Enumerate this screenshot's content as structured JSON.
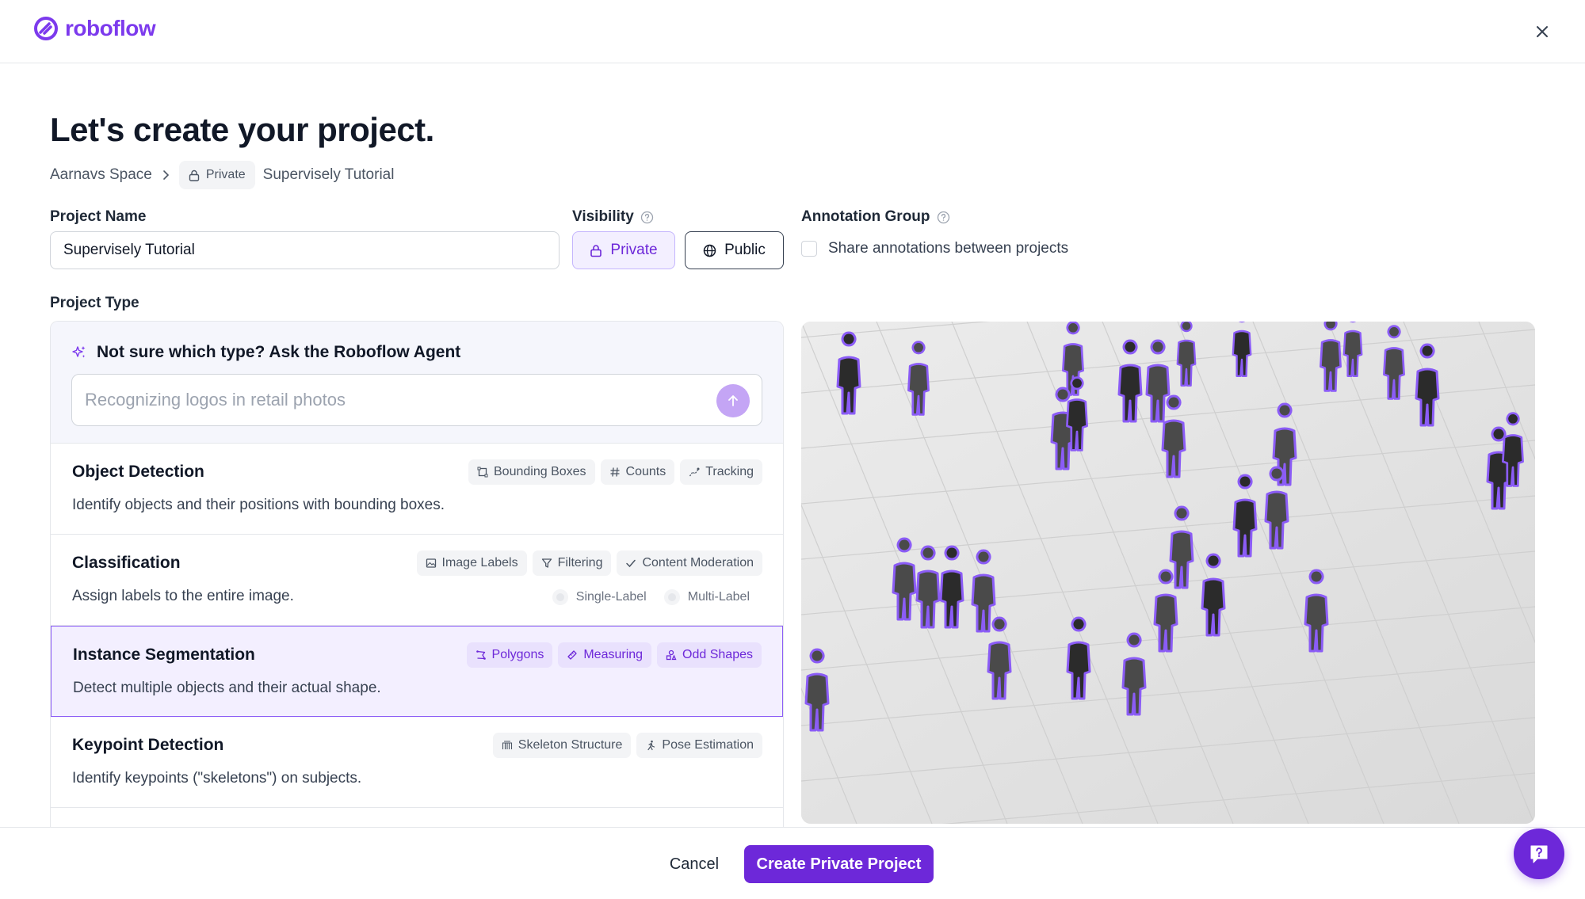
{
  "app": {
    "logo_text": "roboflow",
    "brand_color": "#6d28d9"
  },
  "page": {
    "title": "Let's create your project."
  },
  "breadcrumb": {
    "workspace": "Aarnavs Space",
    "visibility_badge": "Private",
    "project": "Supervisely Tutorial"
  },
  "form": {
    "project_name_label": "Project Name",
    "project_name_value": "Supervisely Tutorial",
    "visibility_label": "Visibility",
    "visibility_options": {
      "private": "Private",
      "public": "Public"
    },
    "visibility_selected": "Private",
    "annotation_group_label": "Annotation Group",
    "share_annotations_label": "Share annotations between projects",
    "share_annotations_checked": false,
    "project_type_label": "Project Type"
  },
  "agent": {
    "title": "Not sure which type? Ask the Roboflow Agent",
    "input_value": "Recognizing logos in retail photos"
  },
  "project_types": [
    {
      "name": "Object Detection",
      "description": "Identify objects and their positions with bounding boxes.",
      "tags": [
        {
          "label": "Bounding Boxes",
          "icon": "bounding-box-icon"
        },
        {
          "label": "Counts",
          "icon": "hash-icon"
        },
        {
          "label": "Tracking",
          "icon": "tracking-icon"
        }
      ],
      "selected": false
    },
    {
      "name": "Classification",
      "description": "Assign labels to the entire image.",
      "tags": [
        {
          "label": "Image Labels",
          "icon": "image-icon"
        },
        {
          "label": "Filtering",
          "icon": "filter-icon"
        },
        {
          "label": "Content Moderation",
          "icon": "check-icon"
        }
      ],
      "options": [
        "Single-Label",
        "Multi-Label"
      ],
      "selected": false
    },
    {
      "name": "Instance Segmentation",
      "description": "Detect multiple objects and their actual shape.",
      "tags": [
        {
          "label": "Polygons",
          "icon": "polygon-icon"
        },
        {
          "label": "Measuring",
          "icon": "ruler-icon"
        },
        {
          "label": "Odd Shapes",
          "icon": "shapes-icon"
        }
      ],
      "selected": true
    },
    {
      "name": "Keypoint Detection",
      "description": "Identify keypoints (\"skeletons\") on subjects.",
      "tags": [
        {
          "label": "Skeleton Structure",
          "icon": "skeleton-icon"
        },
        {
          "label": "Pose Estimation",
          "icon": "running-person-icon"
        }
      ],
      "selected": false
    }
  ],
  "footer": {
    "cancel_label": "Cancel",
    "create_label": "Create Private Project"
  }
}
